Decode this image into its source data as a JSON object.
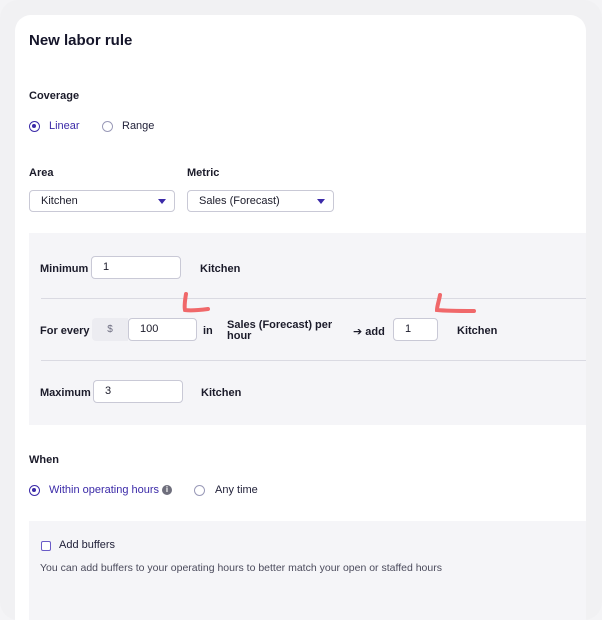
{
  "form": {
    "title": "New labor rule",
    "coverage": {
      "label": "Coverage",
      "options": [
        {
          "label": "Linear",
          "selected": true
        },
        {
          "label": "Range",
          "selected": false
        }
      ]
    },
    "area": {
      "label": "Area",
      "value": "Kitchen"
    },
    "metric": {
      "label": "Metric",
      "value": "Sales (Forecast)"
    },
    "minimum": {
      "label": "Minimum",
      "value": "1",
      "unit": "Kitchen"
    },
    "for_every": {
      "label": "For every",
      "prefix": "$",
      "value": "100",
      "in_text": "in",
      "metric_line1": "Sales (Forecast) per",
      "metric_line2": "hour",
      "add_text": "➔ add",
      "add_value": "1",
      "unit": "Kitchen"
    },
    "maximum": {
      "label": "Maximum",
      "value": "3",
      "unit": "Kitchen"
    },
    "when": {
      "label": "When",
      "options": [
        {
          "label": "Within operating hours",
          "selected": true
        },
        {
          "label": "Any time",
          "selected": false
        }
      ],
      "info_icon": "info-icon"
    },
    "buffers": {
      "label": "Add buffers",
      "checked": false,
      "helper": "You can add buffers to your operating hours to better match your open or staffed hours"
    }
  },
  "colors": {
    "accent": "#3b2aa8",
    "annotation": "#f0686a"
  }
}
